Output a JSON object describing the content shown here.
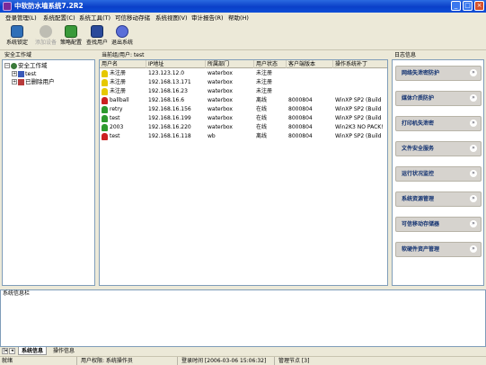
{
  "window": {
    "title": "中软防水墙系统7.2R2",
    "buttons": [
      "_",
      "□",
      "×"
    ]
  },
  "menu": [
    "登录管理(L)",
    "系统配置(C)",
    "系统工具(T)",
    "可信移动存储",
    "系统视图(V)",
    "审计报告(R)",
    "帮助(H)"
  ],
  "toolbar": [
    {
      "label": "系统锁定",
      "icon": "lock-icon",
      "enabled": true
    },
    {
      "label": "添加设备",
      "icon": "add-device-icon",
      "enabled": false
    },
    {
      "label": "策略配置",
      "icon": "policy-icon",
      "enabled": true
    },
    {
      "label": "查找用户",
      "icon": "find-user-icon",
      "enabled": true
    },
    {
      "label": "退出系统",
      "icon": "exit-icon",
      "enabled": true
    }
  ],
  "tree": {
    "header": "安全工作域",
    "items": [
      {
        "label": "安全工作域",
        "level": 0,
        "expander": "−"
      },
      {
        "label": "test",
        "level": 1,
        "expander": "+"
      },
      {
        "label": "已删除用户",
        "level": 1,
        "expander": "+"
      }
    ]
  },
  "main": {
    "header": "当前组/用户: test",
    "columns": [
      "用户名",
      "IP地址",
      "所属部门",
      "用户状态",
      "客户端版本",
      "操作系统补丁"
    ],
    "rows": [
      {
        "name": "未注册",
        "ip": "123.123.12.0",
        "dept": "waterbox",
        "status": "未注册",
        "version": "",
        "os": "",
        "icon": "unregistered"
      },
      {
        "name": "未注册",
        "ip": "192.168.13.171",
        "dept": "waterbox",
        "status": "未注册",
        "version": "",
        "os": "",
        "icon": "unregistered"
      },
      {
        "name": "未注册",
        "ip": "192.168.16.23",
        "dept": "waterbox",
        "status": "未注册",
        "version": "",
        "os": "",
        "icon": "unregistered"
      },
      {
        "name": "ballball",
        "ip": "192.168.16.6",
        "dept": "waterbox",
        "status": "离线",
        "version": "8000804",
        "os": "WinXP SP2 (Build",
        "icon": "offline"
      },
      {
        "name": "retry",
        "ip": "192.168.16.156",
        "dept": "waterbox",
        "status": "在线",
        "version": "8000804",
        "os": "WinXP SP2 (Build",
        "icon": "online"
      },
      {
        "name": "test",
        "ip": "192.168.16.199",
        "dept": "waterbox",
        "status": "在线",
        "version": "8000804",
        "os": "WinXP SP2 (Build",
        "icon": "online"
      },
      {
        "name": "2003",
        "ip": "192.168.16.220",
        "dept": "waterbox",
        "status": "在线",
        "version": "8000804",
        "os": "Win2K3 NO PACK!",
        "icon": "online"
      },
      {
        "name": "test",
        "ip": "192.168.16.118",
        "dept": "wb",
        "status": "离线",
        "version": "8000804",
        "os": "WinXP SP2 (Build",
        "icon": "offline"
      }
    ]
  },
  "log": {
    "header": "日志信息",
    "items": [
      "网络失泄密防护",
      "媒体介质防护",
      "打印机失泄密",
      "文件安全服务",
      "运行状况监控",
      "系统资源管理",
      "可信移动存储器",
      "软硬件资产管理"
    ]
  },
  "messages": {
    "header": "系统信息栏"
  },
  "tabs": [
    "系统信息",
    "操作信息"
  ],
  "status": [
    "就绪",
    "用户权限: 系统操作员",
    "登录时间 [2006-03-06 15:06:32]",
    "管理节点 [3]"
  ],
  "colors": {
    "title": "#0a3fc8",
    "online": "#2d9a2d",
    "offline": "#cc2020",
    "unregistered": "#e6c800"
  }
}
